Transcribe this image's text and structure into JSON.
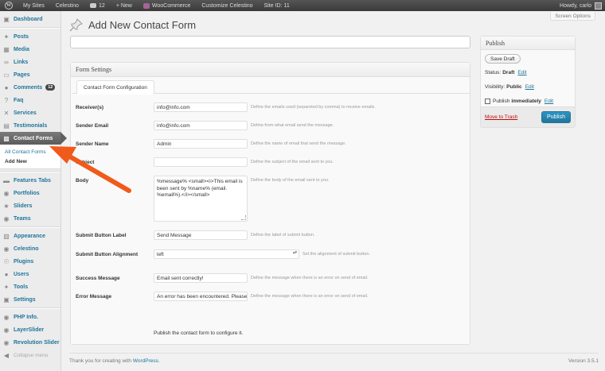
{
  "adminbar": {
    "site_name": "My Sites",
    "site": "Celestino",
    "comments_count": "12",
    "new_label": "+ New",
    "woocommerce": "WooCommerce",
    "customize": "Customize Celestino",
    "site_id": "Site ID: 11",
    "howdy": "Howdy, carlo"
  },
  "sidebar": {
    "dashboard": "Dashboard",
    "posts": "Posts",
    "media": "Media",
    "links": "Links",
    "pages": "Pages",
    "comments": "Comments",
    "comments_badge": "12",
    "faq": "Faq",
    "services": "Services",
    "testimonials": "Testimonials",
    "contact_forms": "Contact Forms",
    "all_contact_forms": "All Contact Forms",
    "add_new": "Add New",
    "features_tabs": "Features Tabs",
    "portfolios": "Portfolios",
    "sliders": "Sliders",
    "teams": "Teams",
    "appearance": "Appearance",
    "celestino": "Celestino",
    "plugins": "Plugins",
    "users": "Users",
    "tools": "Tools",
    "settings": "Settings",
    "php_info": "PHP Info.",
    "layerslider": "LayerSlider",
    "revolution_slider": "Revolution Slider",
    "collapse": "Collapse menu"
  },
  "screen_options": "Screen Options",
  "page_title": "Add New Contact Form",
  "form": {
    "box_title": "Form Settings",
    "tab": "Contact Form Configuration",
    "fields": {
      "receivers": {
        "label": "Receiver(s)",
        "value": "info@info.com",
        "help": "Define the emails used (separeted by comma) to receive emails."
      },
      "sender_email": {
        "label": "Sender Email",
        "value": "info@info.com",
        "help": "Define from what email send the message."
      },
      "sender_name": {
        "label": "Sender Name",
        "value": "Admin",
        "help": "Define the name of email that send the message."
      },
      "subject": {
        "label": "Subject",
        "value": "",
        "help": "Define the subject of the email sent to you."
      },
      "body": {
        "label": "Body",
        "value": "%message%  <small><i>This email is been sent by %name% (email. %email%).</i></small>",
        "help": "Define the body of the email sent to you."
      },
      "submit_label": {
        "label": "Submit Button Label",
        "value": "Send Message",
        "help": "Define the label of submit button."
      },
      "submit_alignment": {
        "label": "Submit Button Alignment",
        "value": "left",
        "help": "Set the alignment of submit button."
      },
      "success_message": {
        "label": "Success Message",
        "value": "Email sent correctly!",
        "help": "Define the message when there is an error on send of email."
      },
      "error_message": {
        "label": "Error Message",
        "value": "An error has been encountered. Please",
        "help": "Define the message when there is an error on send of email."
      }
    },
    "note": "Publish the contact form to configure it."
  },
  "publish": {
    "title": "Publish",
    "save_draft": "Save Draft",
    "status_label": "Status:",
    "status_value": "Draft",
    "visibility_label": "Visibility:",
    "visibility_value": "Public",
    "publish_label": "Publish",
    "publish_value": "immediately",
    "edit": "Edit",
    "move_to_trash": "Move to Trash",
    "publish_button": "Publish"
  },
  "footer": {
    "thanks": "Thank you for creating with",
    "wordpress": "WordPress",
    "version": "Version 3.5.1"
  },
  "colors": {
    "accent": "#21759b",
    "arrow": "#f05a1a",
    "trash": "#bc0b0b"
  }
}
